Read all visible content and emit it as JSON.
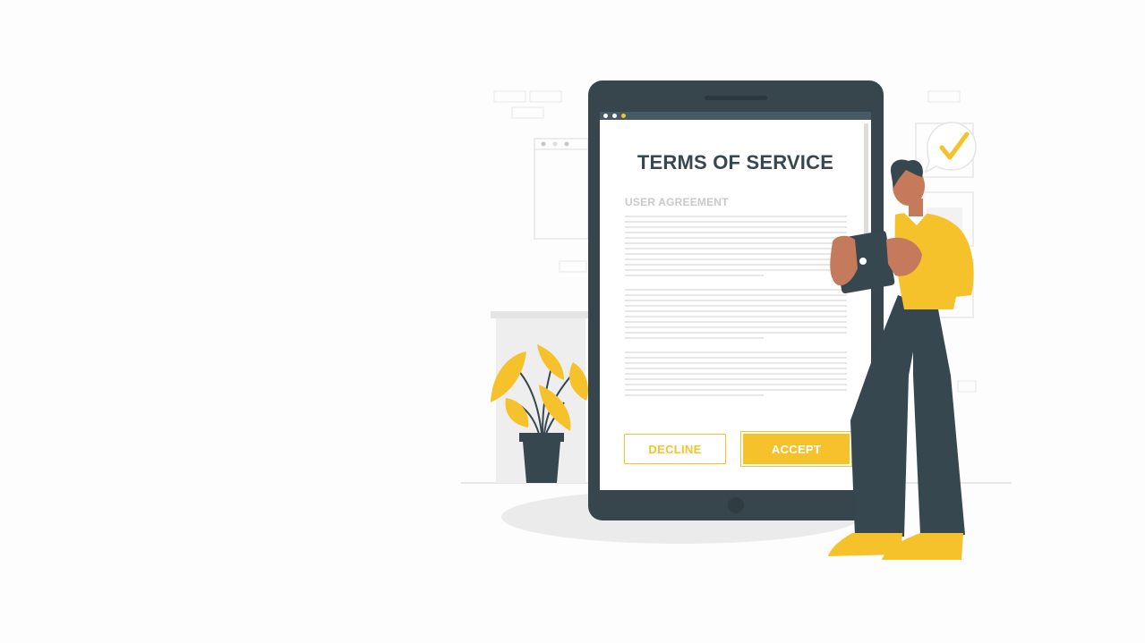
{
  "screen": {
    "title": "TERMS OF SERVICE",
    "subtitle": "USER AGREEMENT",
    "decline_label": "DECLINE",
    "accept_label": "ACCEPT"
  },
  "colors": {
    "accent": "#f5c22b",
    "device": "#37464d",
    "text_dark": "#37474f",
    "text_muted": "#c9c9c9"
  },
  "icons": [
    "checkmark-icon",
    "speech-bubble-icon",
    "plant-illustration",
    "person-illustration"
  ]
}
